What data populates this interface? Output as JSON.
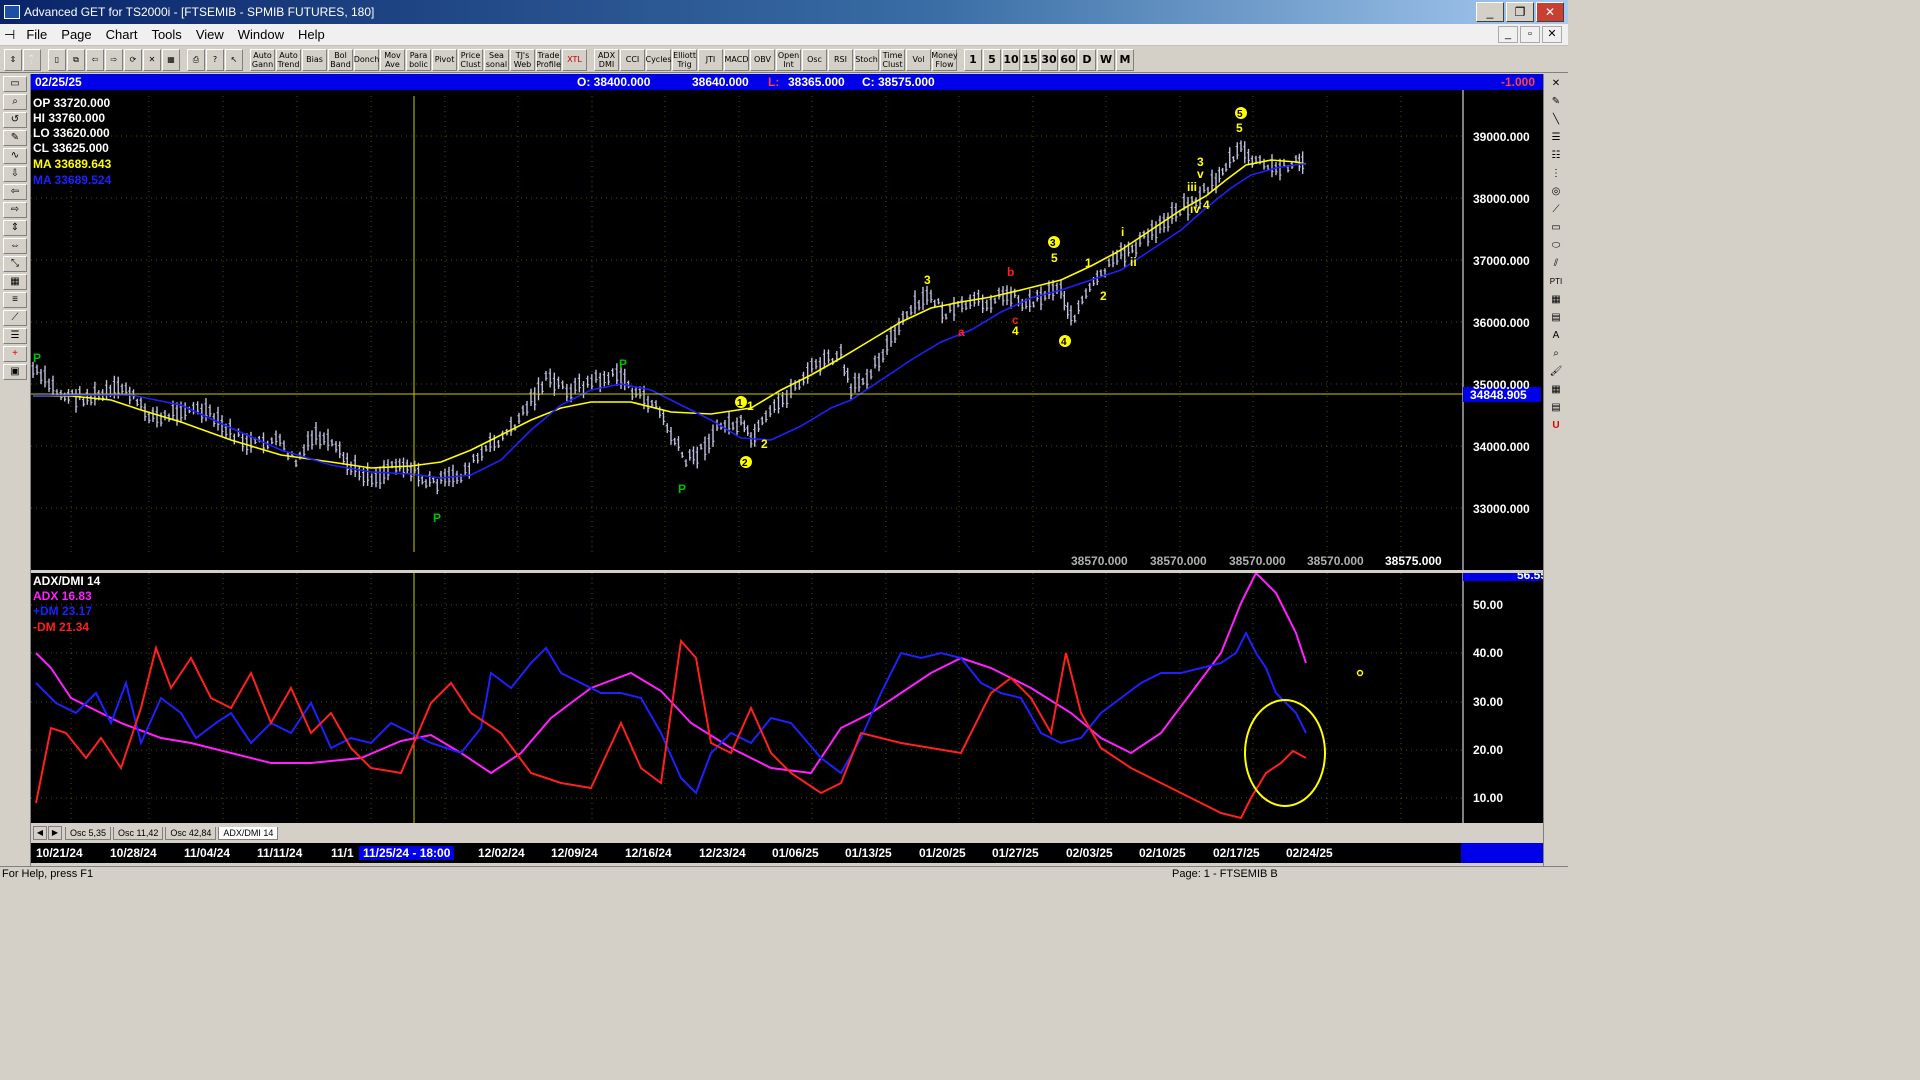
{
  "window": {
    "title": "Advanced GET for TS2000i - [FTSEMIB - SPMIB FUTURES, 180]",
    "buttons": [
      "_",
      "❐",
      "✕"
    ]
  },
  "menu": {
    "items": [
      "File",
      "Page",
      "Chart",
      "Tools",
      "View",
      "Window",
      "Help"
    ],
    "mdi_buttons": [
      "_",
      "▫",
      "✕"
    ]
  },
  "toolbar": {
    "study_buttons": [
      "Auto Gann",
      "Auto Trend",
      "Bias",
      "Bol Band",
      "Donch",
      "Mov Ave",
      "Para bolic",
      "Pivot",
      "Price Clust",
      "Sea sonal",
      "TJ's Web",
      "Trade Profile",
      "XTL",
      "ADX DMI",
      "CCI",
      "Cycles",
      "Elliott Trig",
      "JTI",
      "MACD",
      "OBV",
      "Open Int",
      "Osc",
      "RSI",
      "Stoch",
      "Time Clust",
      "Vol",
      "Money Flow"
    ],
    "interval_buttons": [
      "1",
      "5",
      "10",
      "15",
      "30",
      "60",
      "D",
      "W",
      "M"
    ]
  },
  "infobar": {
    "date": "02/25/25",
    "open": "O: 38400.000",
    "high": "38640.000",
    "low_label": "L:",
    "low": "38365.000",
    "close": "C: 38575.000",
    "change": "-1.000"
  },
  "price_legend": {
    "op": "OP  33720.000",
    "hi": "HI   33760.000",
    "lo": "LO  33620.000",
    "cl": "CL  33625.000",
    "ma1": "MA  33689.643",
    "ma2": "MA  33689.524"
  },
  "price_axis": {
    "ticks": [
      "39000.000",
      "38000.000",
      "37000.000",
      "36000.000",
      "35000.000",
      "34000.000",
      "33000.000"
    ],
    "cursor_value": "34848.905",
    "bottom_values": [
      "38570.000",
      "38570.000",
      "38570.000",
      "38570.000",
      "38575.000"
    ]
  },
  "elliott_labels": {
    "p": "P",
    "one": "1",
    "two": "2",
    "three": "3",
    "four": "4",
    "five": "5",
    "a": "a",
    "b": "b",
    "c": "c",
    "i": "i",
    "ii": "ii",
    "iii": "iii",
    "iv": "iv",
    "v": "v",
    "circ1": "1",
    "circ2": "2",
    "circ3": "3",
    "circ4": "4",
    "circ5": "5"
  },
  "adx_legend": {
    "title": "ADX/DMI 14",
    "adx": "ADX 16.83",
    "pdm": "+DM 23.17",
    "mdm": "-DM  21.34"
  },
  "adx_axis": {
    "ticks": [
      "50.00",
      "40.00",
      "30.00",
      "20.00",
      "10.00"
    ],
    "top_value": "56.55"
  },
  "tabs": [
    "Osc 5,35",
    "Osc 11,42",
    "Osc 42,84",
    "ADX/DMI 14"
  ],
  "date_axis": {
    "labels": [
      "10/21/24",
      "10/28/24",
      "11/04/24",
      "11/11/24",
      "11/1",
      "12/02/24",
      "12/09/24",
      "12/16/24",
      "12/23/24",
      "01/06/25",
      "01/13/25",
      "01/20/25",
      "01/27/25",
      "02/03/25",
      "02/10/25",
      "02/17/25",
      "02/24/25"
    ],
    "cursor": "11/25/24 - 18:00"
  },
  "status": {
    "help": "For Help, press F1",
    "page": "Page: 1 - FTSEMIB B"
  },
  "colors": {
    "ma_yellow": "#ffff00",
    "ma_blue": "#2020ff",
    "adx_magenta": "#ff20ff",
    "pdm_blue": "#2020ff",
    "mdm_red": "#ff2020",
    "wave_green": "#00c000",
    "wave_red": "#ff2020"
  }
}
